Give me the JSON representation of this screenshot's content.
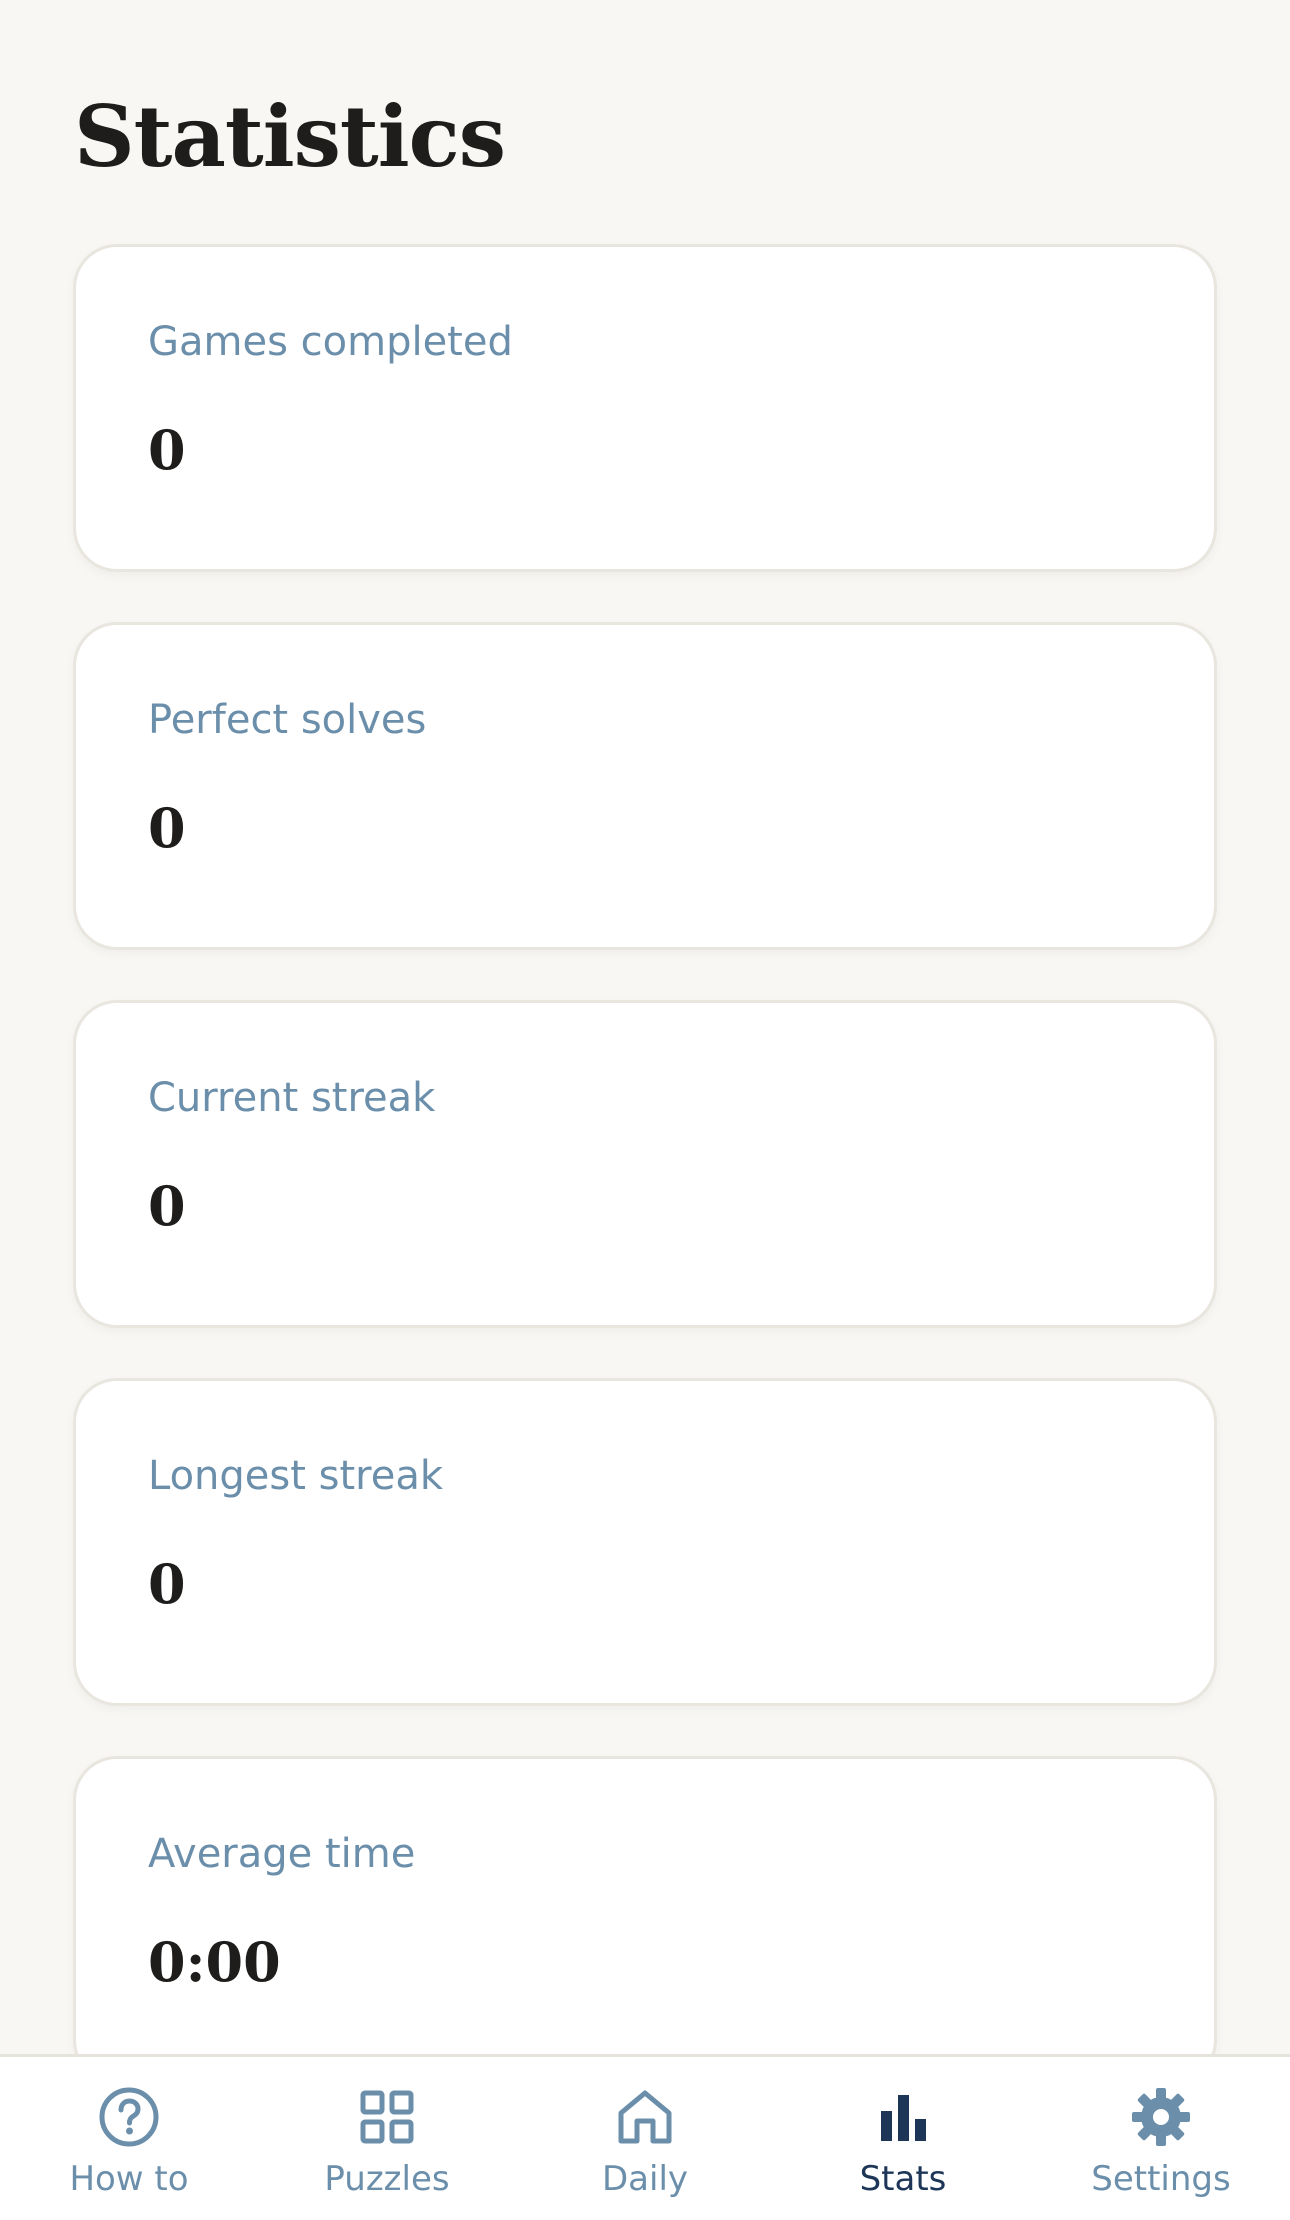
{
  "title": "Statistics",
  "stats": [
    {
      "label": "Games completed",
      "value": "0"
    },
    {
      "label": "Perfect solves",
      "value": "0"
    },
    {
      "label": "Current streak",
      "value": "0"
    },
    {
      "label": "Longest streak",
      "value": "0"
    },
    {
      "label": "Average time",
      "value": "0:00"
    }
  ],
  "nav": {
    "items": [
      {
        "label": "How to",
        "icon": "question-circle-icon"
      },
      {
        "label": "Puzzles",
        "icon": "grid-icon"
      },
      {
        "label": "Daily",
        "icon": "home-icon"
      },
      {
        "label": "Stats",
        "icon": "bar-chart-icon"
      },
      {
        "label": "Settings",
        "icon": "gear-icon"
      }
    ],
    "active": "Stats"
  },
  "colors": {
    "background": "#f8f7f4",
    "card": "#ffffff",
    "label": "#6b8fab",
    "value": "#1f1d1c",
    "nav_inactive": "#6b8fab",
    "nav_active": "#1d3557"
  }
}
